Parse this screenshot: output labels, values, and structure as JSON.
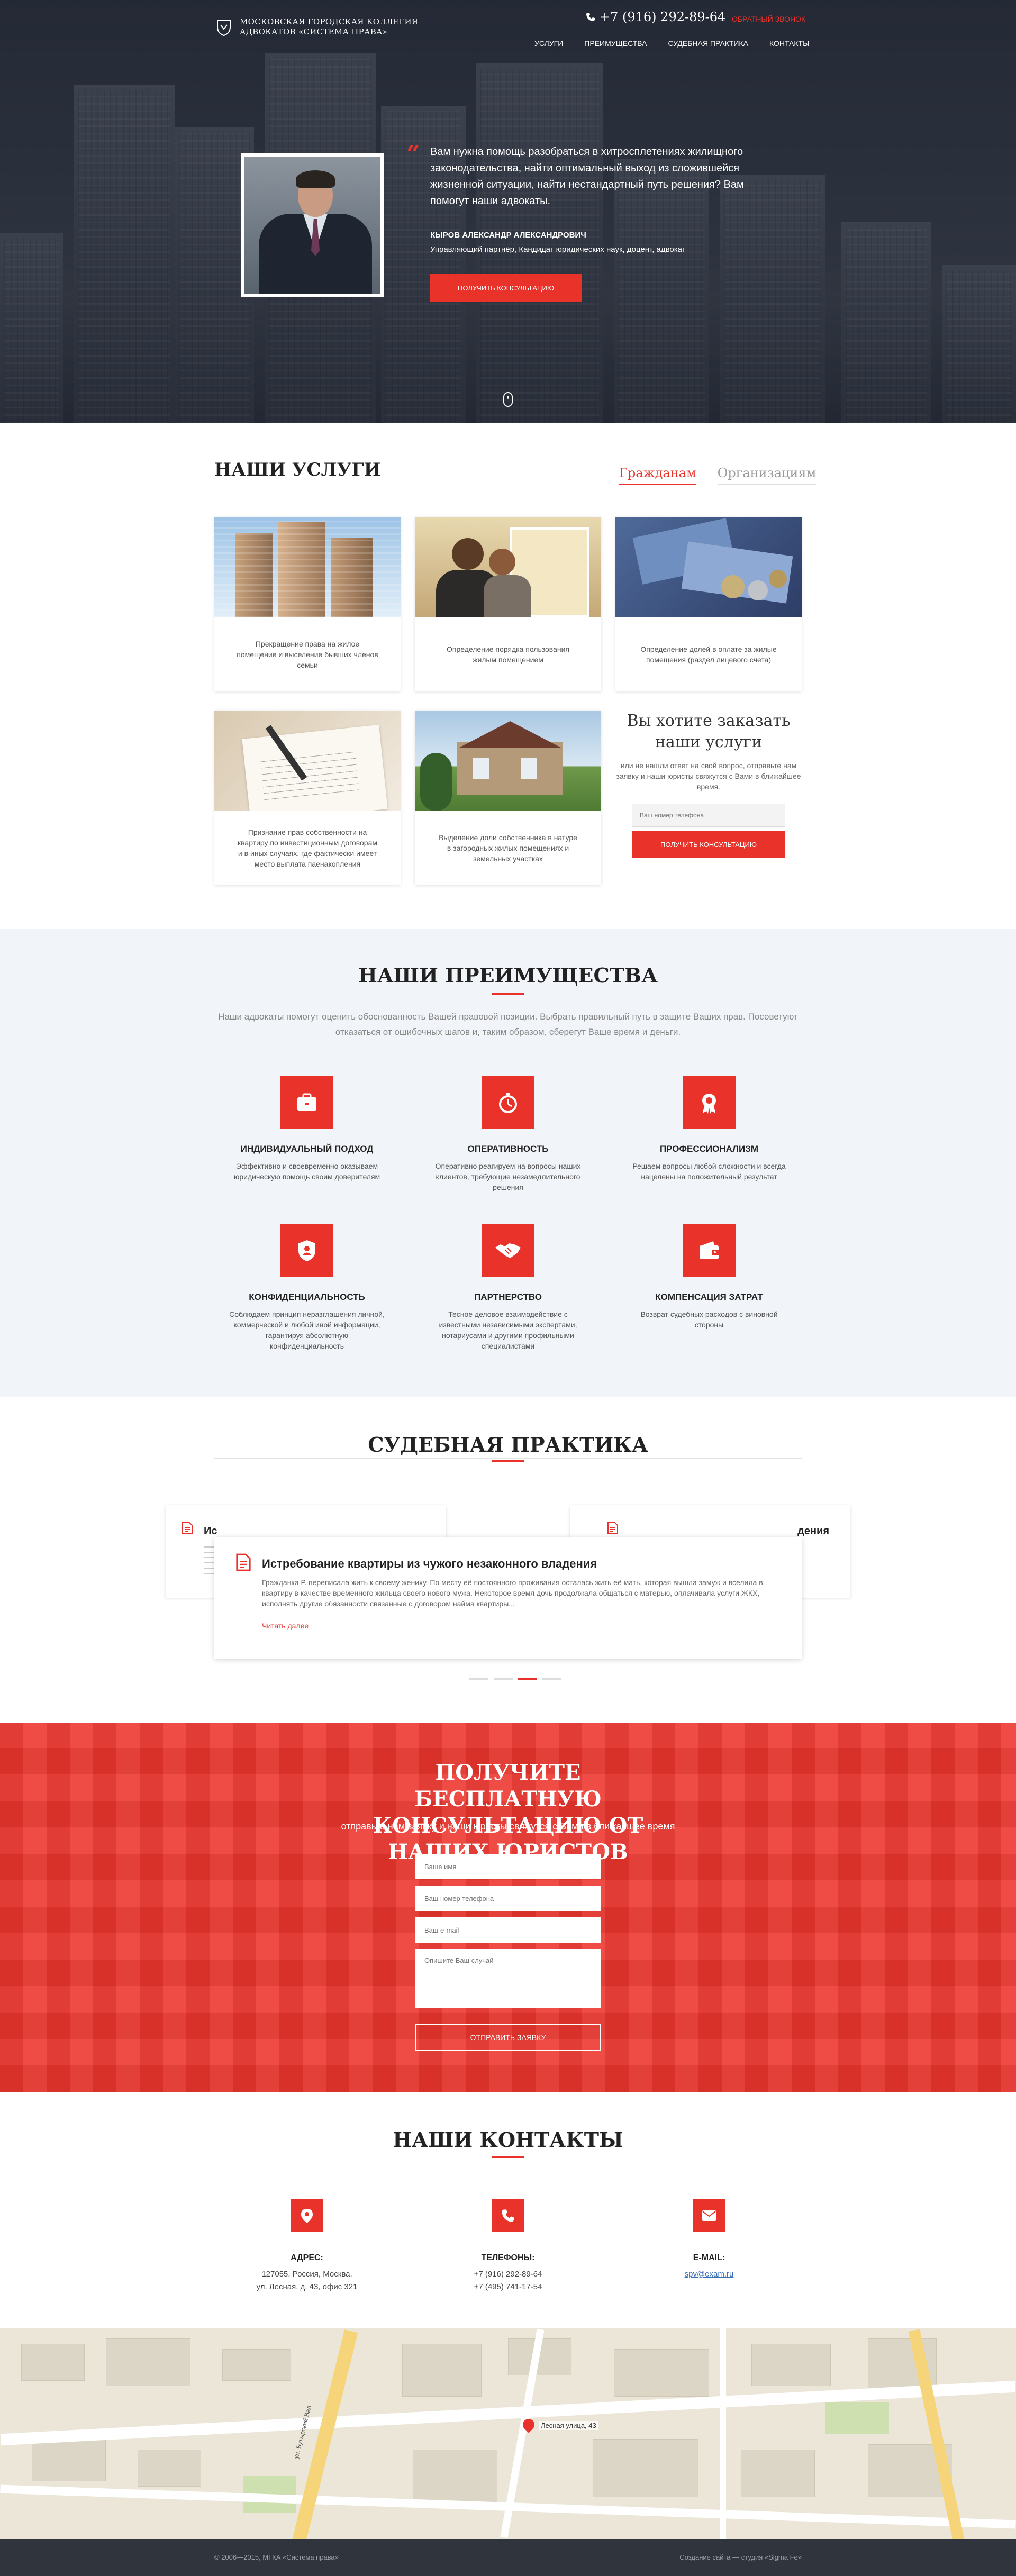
{
  "header": {
    "logo_line1": "МОСКОВСКАЯ ГОРОДСКАЯ КОЛЛЕГИЯ",
    "logo_line2": "АДВОКАТОВ «СИСТЕМА ПРАВА»",
    "phone": "+7 (916) 292-89-64",
    "callback": "ОБРАТНЫЙ ЗВОНОК",
    "nav": [
      "УСЛУГИ",
      "ПРЕИМУЩЕСТВА",
      "СУДЕБНАЯ ПРАКТИКА",
      "КОНТАКТЫ"
    ]
  },
  "hero": {
    "quote": "Вам нужна помощь разобраться в хитросплетениях жилищного законодательства, найти оптимальный выход из сложившейся жизненной ситуации, найти нестандартный путь решения? Вам помогут наши адвокаты.",
    "name": "КЫРОВ АЛЕКСАНДР АЛЕКСАНДРОВИЧ",
    "title": "Управляющий партнёр, Кандидат юридических наук, доцент, адвокат",
    "button": "ПОЛУЧИТЬ КОНСУЛЬТАЦИЮ"
  },
  "services": {
    "title": "НАШИ УСЛУГИ",
    "tabs": [
      "Гражданам",
      "Организациям"
    ],
    "active_tab": "Гражданам",
    "cards": [
      "Прекращение права на жилое помещение и выселение бывших членов семьи",
      "Определение порядка пользования жилым помещением",
      "Определение долей в оплате за жилые помещения (раздел лицевого счета)",
      "Признание прав собственности на квартиру по инвестиционным договорам и в иных случаях, где фактически имеет место выплата паенакопления",
      "Выделение доли собственника в натуре в загородных жилых помещениях и земельных участках"
    ],
    "order": {
      "title": "Вы хотите заказать наши услуги",
      "text": "или не нашли ответ на свой вопрос, отправьте нам заявку и наши юристы свяжутся с Вами в ближайшее время.",
      "placeholder": "Ваш номер телефона",
      "button": "ПОЛУЧИТЬ КОНСУЛЬТАЦИЮ"
    }
  },
  "advantages": {
    "title": "НАШИ ПРЕИМУЩЕСТВА",
    "lead": "Наши адвокаты помогут оценить обоснованность Вашей правовой позиции. Выбрать правильный путь в защите Ваших прав. Посоветуют отказаться от ошибочных шагов и, таким образом, сберегут Ваше время и деньги.",
    "items": [
      {
        "icon": "briefcase-icon",
        "title": "ИНДИВИДУАЛЬНЫЙ ПОДХОД",
        "text": "Эффективно и своевременно оказываем юридическую помощь своим доверителям"
      },
      {
        "icon": "stopwatch-icon",
        "title": "ОПЕРАТИВНОСТЬ",
        "text": "Оперативно реагируем на вопросы наших клиентов, требующие незамедлительного решения"
      },
      {
        "icon": "award-icon",
        "title": "ПРОФЕССИОНАЛИЗМ",
        "text": "Решаем вопросы любой сложности и всегда нацелены на положительный результат"
      },
      {
        "icon": "shield-user-icon",
        "title": "КОНФИДЕНЦИАЛЬНОСТЬ",
        "text": "Соблюдаем принцип неразглашения личной, коммерческой и любой иной информации, гарантируя абсолютную конфиденциальность"
      },
      {
        "icon": "handshake-icon",
        "title": "ПАРТНЕРСТВО",
        "text": "Тесное деловое взаимодействие с известными независимыми экспертами, нотариусами и другими профильными специалистами"
      },
      {
        "icon": "wallet-icon",
        "title": "КОМПЕНСАЦИЯ ЗАТРАТ",
        "text": "Возврат судебных расходов с виновной стороны"
      }
    ]
  },
  "practice": {
    "title": "СУДЕБНАЯ ПРАКТИКА",
    "case_title": "Истребование квартиры из чужого незаконного владения",
    "case_text": "Гражданка Р. переписала жить к своему жениху. По месту её постоянного проживания осталась жить её мать, которая вышла замуж и вселила в квартиру в качестве временного жильца своего нового мужа. Некоторое время дочь продолжала общаться с матерью, оплачивала услуги ЖКХ, исполнять другие обязанности связанные с договором найма квартиры...",
    "more": "Читать далее",
    "left_peek_title": "Ис",
    "right_peek_title": "дения"
  },
  "consult": {
    "title": "ПОЛУЧИТЕ БЕСПЛАТНУЮ КОНСУЛЬТАЦИЮ ОТ НАШИХ ЮРИСТОВ",
    "subtitle": "отправьте нам заявку и наши юристы свяжутся с Вами в ближайшее время",
    "name_placeholder": "Ваше имя",
    "phone_placeholder": "Ваш номер телефона",
    "email_placeholder": "Ваш e-mail",
    "message_placeholder": "Опишите Ваш случай",
    "button": "ОТПРАВИТЬ ЗАЯВКУ"
  },
  "contacts": {
    "title": "НАШИ КОНТАКТЫ",
    "address_title": "АДРЕС:",
    "address": [
      "127055, Россия, Москва,",
      "ул. Лесная, д. 43, офис 321"
    ],
    "phones_title": "ТЕЛЕФОНЫ:",
    "phones": [
      "+7 (916) 292-89-64",
      "+7 (495) 741-17-54"
    ],
    "email_title": "E-MAIL:",
    "email": "spv@exam.ru"
  },
  "map": {
    "pin_label": "Лесная улица, 43",
    "street_label": "ул. Бутырский Вал"
  },
  "footer": {
    "copyright": "© 2006—2015, МГКА «Система права»",
    "credit": "Создание сайта — студия «Sigma Fe»"
  },
  "colors": {
    "accent": "#e8322a",
    "footer": "#2f343d",
    "advantages_bg": "#f1f4f8"
  }
}
